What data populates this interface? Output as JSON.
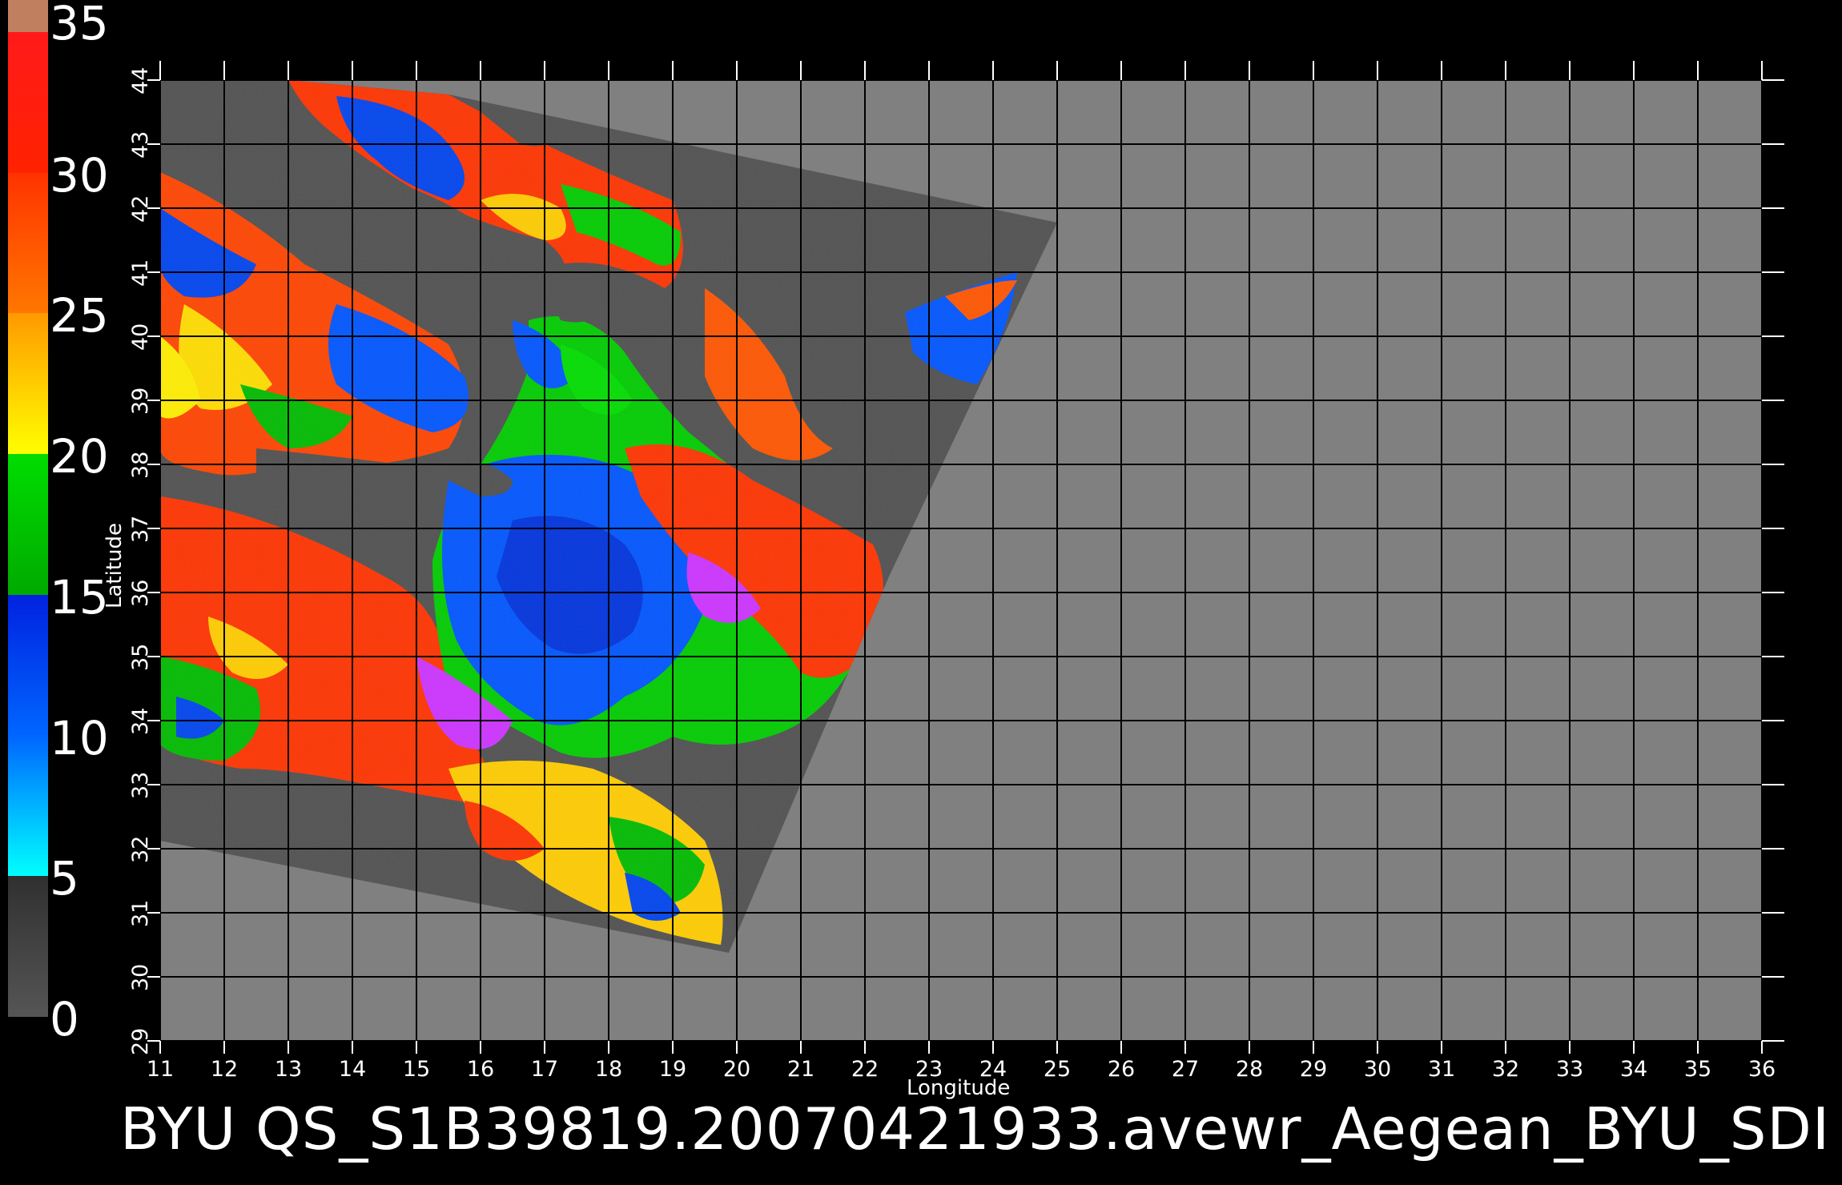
{
  "title": "BYU  QS_S1B39819.20070421933.avewr_Aegean_BYU_SDI",
  "axes": {
    "xlabel": "Longitude",
    "ylabel": "Latitude",
    "lon_ticks": [
      "11",
      "12",
      "13",
      "14",
      "15",
      "16",
      "17",
      "18",
      "19",
      "20",
      "21",
      "22",
      "23",
      "24",
      "25",
      "26",
      "27",
      "28",
      "29",
      "30",
      "31",
      "32",
      "33",
      "34",
      "35",
      "36"
    ],
    "lat_ticks": [
      "29",
      "30",
      "31",
      "32",
      "33",
      "34",
      "35",
      "36",
      "37",
      "38",
      "39",
      "40",
      "41",
      "42",
      "43",
      "44"
    ]
  },
  "colorbar": {
    "labels": [
      "35",
      "30",
      "25",
      "20",
      "15",
      "10",
      "5",
      "0"
    ],
    "stops": [
      {
        "from": 0,
        "to": 5,
        "colors": [
          "#555555",
          "#303030"
        ]
      },
      {
        "from": 5,
        "to": 10,
        "colors": [
          "#00ffff",
          "#0066ff"
        ]
      },
      {
        "from": 10,
        "to": 15,
        "colors": [
          "#0066ff",
          "#0022e0"
        ]
      },
      {
        "from": 15,
        "to": 20,
        "colors": [
          "#00aa00",
          "#00dd00"
        ]
      },
      {
        "from": 20,
        "to": 25,
        "colors": [
          "#ffff00",
          "#ff9900"
        ]
      },
      {
        "from": 25,
        "to": 30,
        "colors": [
          "#ff7700",
          "#ff3300"
        ]
      },
      {
        "from": 30,
        "to": 35,
        "colors": [
          "#ff2200",
          "#ff1a1a"
        ]
      }
    ],
    "top_color": "#c08060"
  },
  "colors": {
    "background": "#000000",
    "land": "#808080",
    "swath_nodata": "#505050",
    "grid": "#000000"
  }
}
